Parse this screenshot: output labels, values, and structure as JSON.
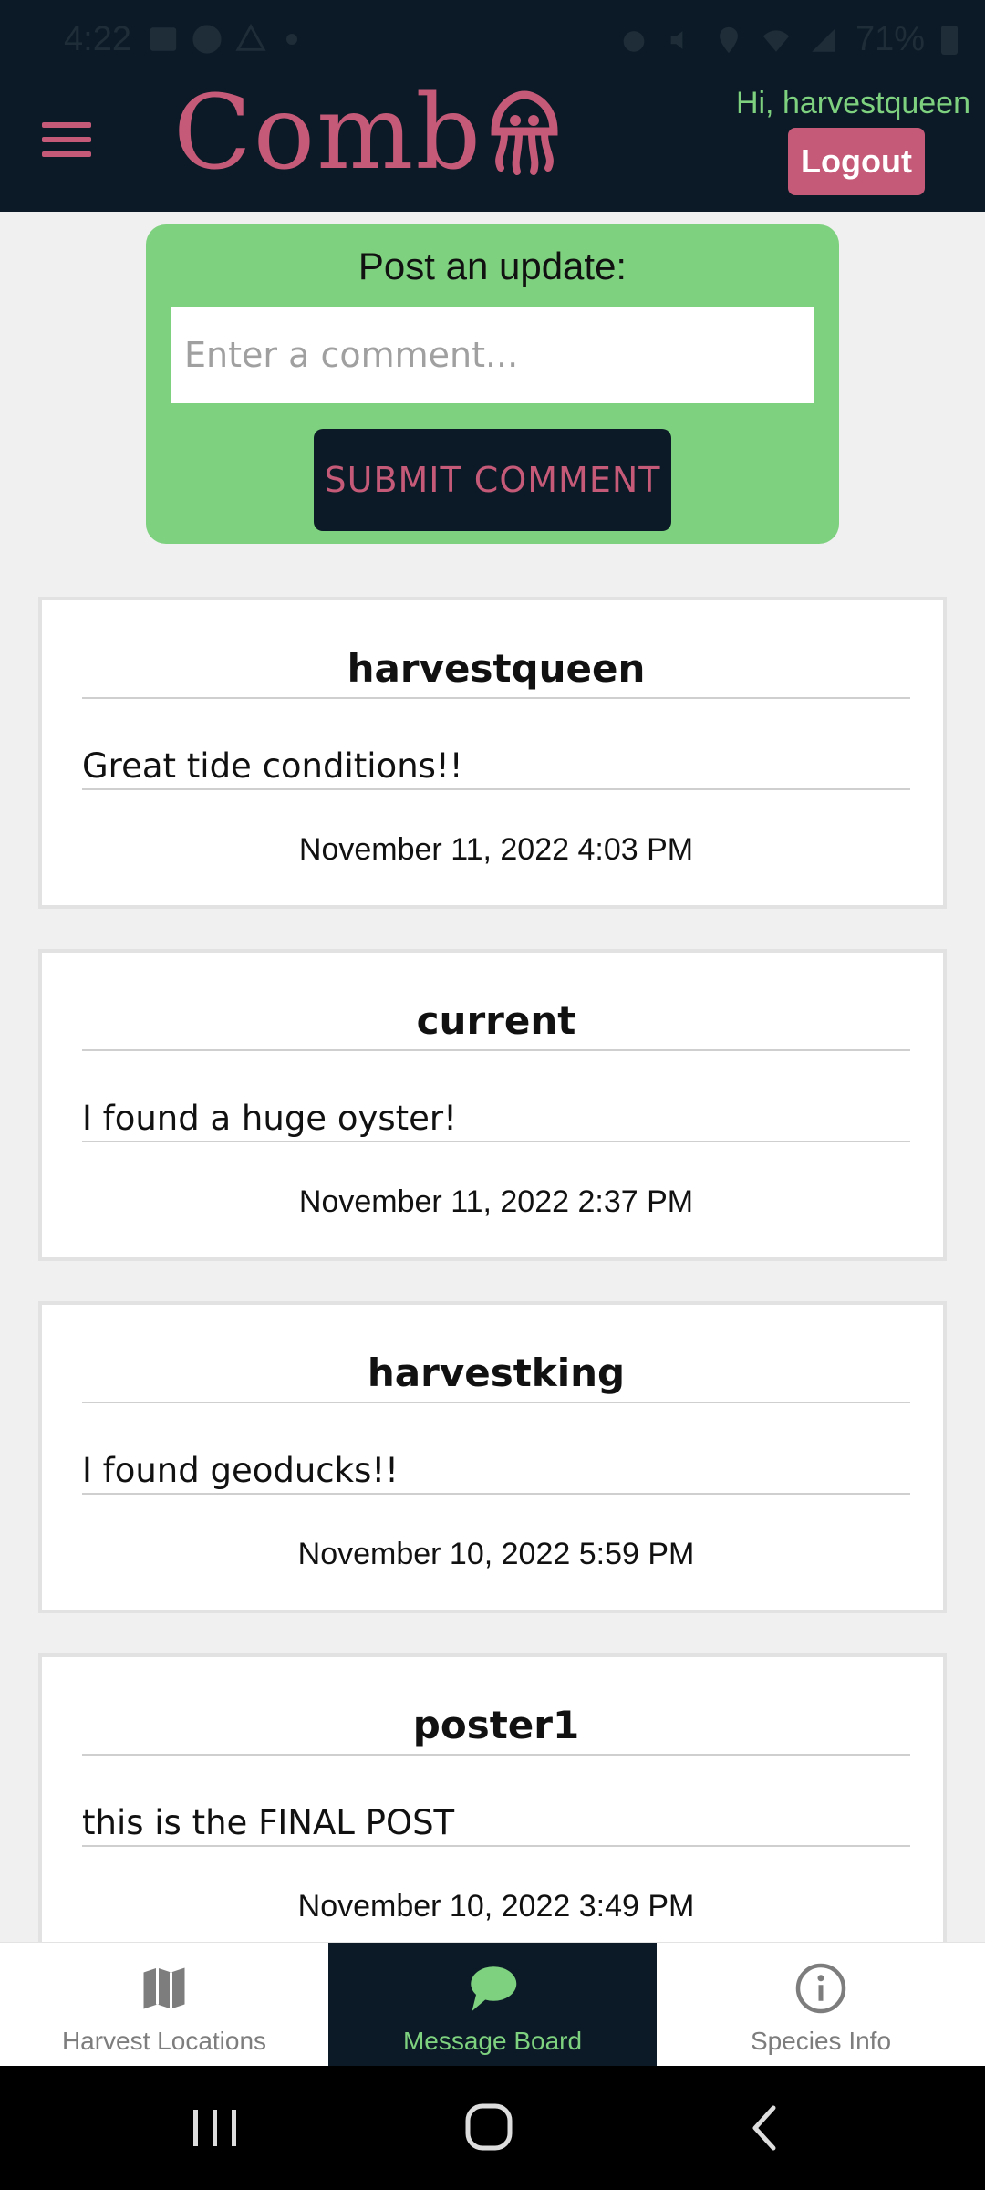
{
  "status_bar": {
    "time": "4:22",
    "battery": "71%"
  },
  "header": {
    "logo_text": "Comb",
    "greeting": "Hi, harvestqueen",
    "logout_label": "Logout"
  },
  "post_update": {
    "title": "Post an update:",
    "placeholder": "Enter a comment...",
    "submit_label": "SUBMIT COMMENT"
  },
  "messages": [
    {
      "user": "harvestqueen",
      "text": "Great tide conditions!!",
      "date": "November 11, 2022 4:03 PM"
    },
    {
      "user": "current",
      "text": "I found a huge oyster!",
      "date": "November 11, 2022 2:37 PM"
    },
    {
      "user": "harvestking",
      "text": "I found geoducks!!",
      "date": "November 10, 2022 5:59 PM"
    },
    {
      "user": "poster1",
      "text": "this is the FINAL POST",
      "date": "November 10, 2022 3:49 PM"
    }
  ],
  "tabs": [
    {
      "label": "Harvest Locations",
      "icon": "map-icon",
      "active": false
    },
    {
      "label": "Message Board",
      "icon": "chat-bubble-icon",
      "active": true
    },
    {
      "label": "Species Info",
      "icon": "info-icon",
      "active": false
    }
  ],
  "colors": {
    "header_bg": "#0b1a26",
    "brand_pink": "#c45a78",
    "accent_green": "#7ed17f"
  }
}
